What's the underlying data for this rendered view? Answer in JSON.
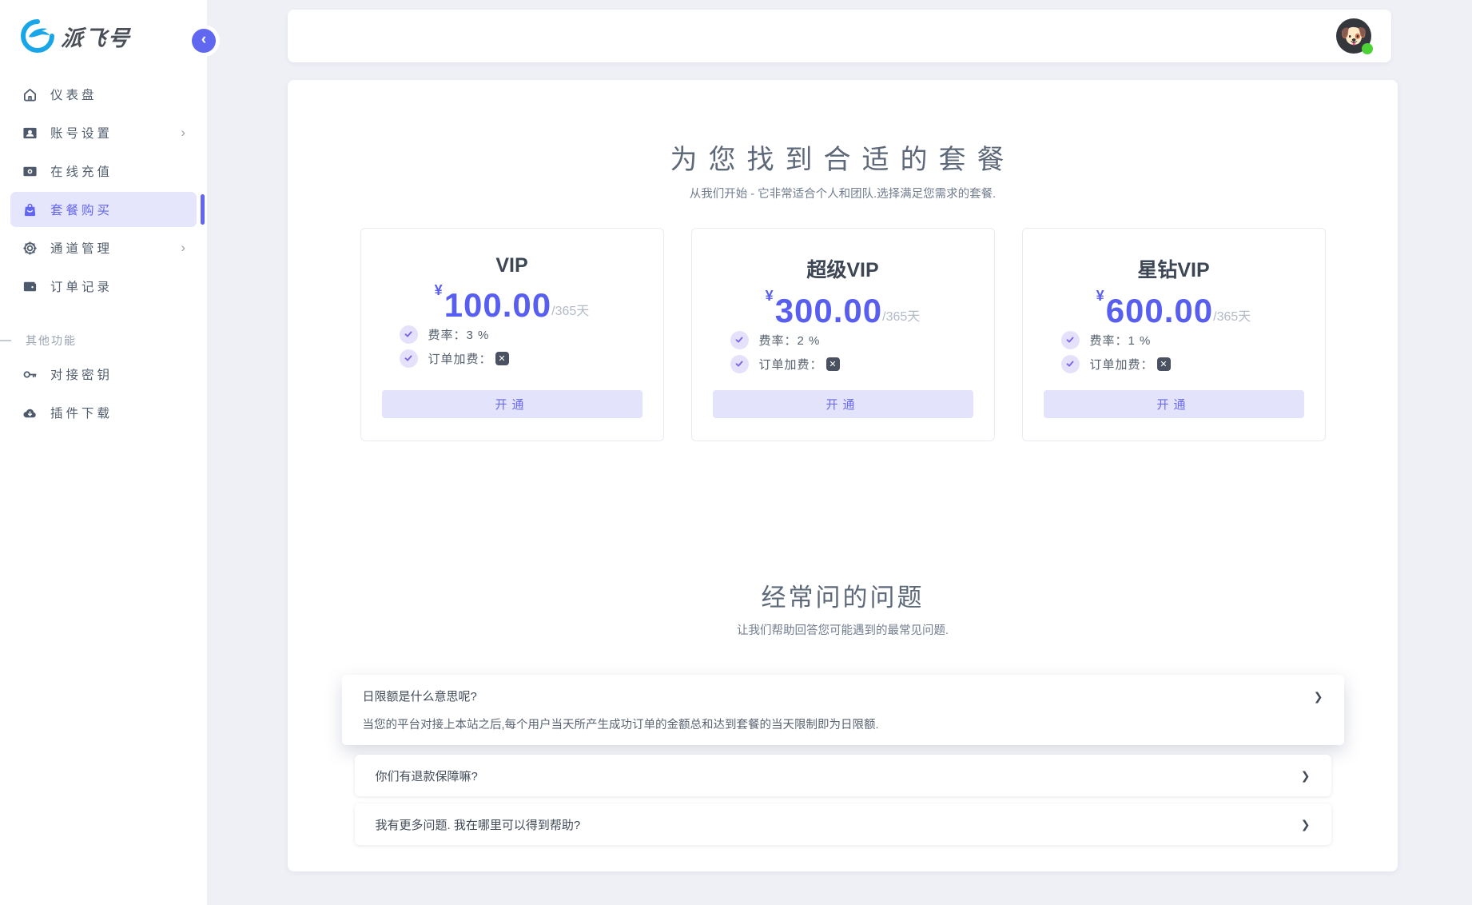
{
  "logo": {
    "text": "派飞号"
  },
  "sidebar": {
    "items": [
      {
        "label": "仪表盘"
      },
      {
        "label": "账号设置"
      },
      {
        "label": "在线充值"
      },
      {
        "label": "套餐购买"
      },
      {
        "label": "通道管理"
      },
      {
        "label": "订单记录"
      }
    ],
    "section_label": "其他功能",
    "extra_items": [
      {
        "label": "对接密钥"
      },
      {
        "label": "插件下载"
      }
    ]
  },
  "header": {
    "avatar_glyph": "🐶"
  },
  "pricing": {
    "title": "为您找到合适的套餐",
    "subtitle": "从我们开始 - 它非常适合个人和团队.选择满足您需求的套餐.",
    "currency": "¥",
    "period": "/365天",
    "plans": [
      {
        "name": "VIP",
        "price": "100.00",
        "rate": "费率：3 %",
        "surcharge": "订单加费：",
        "button": "开通"
      },
      {
        "name": "超级VIP",
        "price": "300.00",
        "rate": "费率：2 %",
        "surcharge": "订单加费：",
        "button": "开通"
      },
      {
        "name": "星钻VIP",
        "price": "600.00",
        "rate": "费率：1 %",
        "surcharge": "订单加费：",
        "button": "开通"
      }
    ]
  },
  "faq": {
    "title": "经常问的问题",
    "subtitle": "让我们帮助回答您可能遇到的最常见问题.",
    "items": [
      {
        "question": "日限额是什么意思呢?",
        "answer": "当您的平台对接上本站之后,每个用户当天所产生成功订单的金额总和达到套餐的当天限制即为日限额."
      },
      {
        "question": "你们有退款保障嘛?",
        "answer": ""
      },
      {
        "question": "我有更多问题. 我在哪里可以得到帮助?",
        "answer": ""
      }
    ]
  },
  "colors": {
    "accent": "#6366f1",
    "price": "#585ef0",
    "active_bg": "#e5e5fb",
    "button_bg": "#e3e3fb",
    "logo_blue": "#19a6e8",
    "online": "#4cd137"
  }
}
